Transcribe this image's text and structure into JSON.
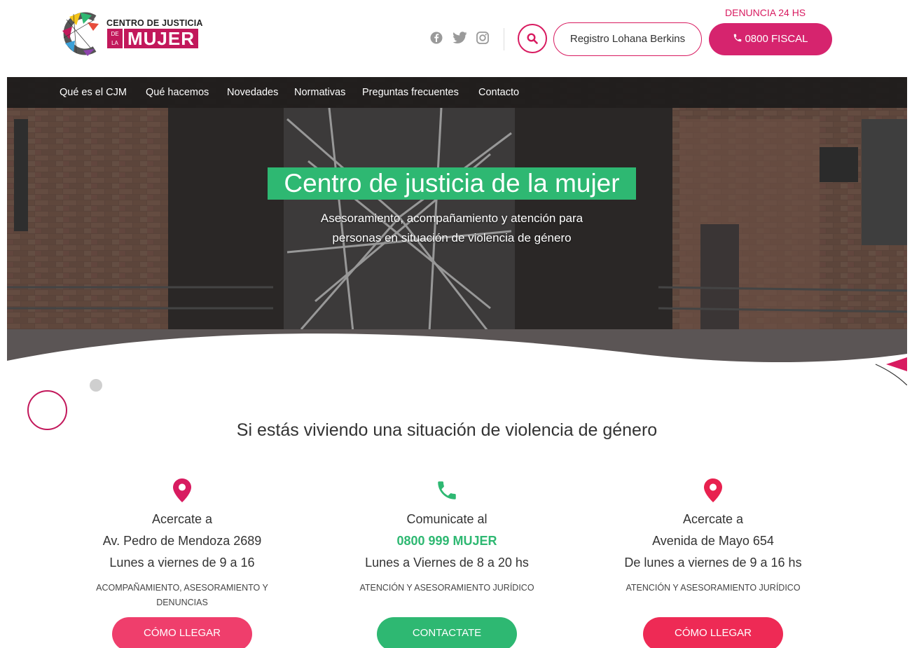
{
  "brand": {
    "top": "CENTRO DE JUSTICIA",
    "de": "DE",
    "la": "LA",
    "mujer": "MUJER"
  },
  "header": {
    "social": [
      "facebook-icon",
      "twitter-icon",
      "instagram-icon"
    ],
    "registro_label": "Registro Lohana Berkins",
    "denuncia_label": "DENUNCIA 24 HS",
    "fiscal_label": "0800 FISCAL"
  },
  "nav": {
    "items": [
      "Qué es el CJM",
      "Qué hacemos",
      "Novedades",
      "Normativas",
      "Preguntas frecuentes",
      "Contacto"
    ]
  },
  "hero": {
    "title": "Centro de justicia de la mujer",
    "subtitle_line1": "Asesoramiento, acompañamiento y atención para",
    "subtitle_line2": "personas en situación de violencia de género"
  },
  "section": {
    "title": "Si estás viviendo una situación de violencia de género"
  },
  "columns": [
    {
      "icon": "map-pin-icon",
      "line1": "Acercate a",
      "line2": "Av. Pedro de Mendoza 2689",
      "line3": "Lunes a viernes de 9 a 16",
      "desc": "ACOMPAÑAMIENTO, ASESORAMIENTO Y DENUNCIAS",
      "button": "CÓMO LLEGAR"
    },
    {
      "icon": "phone-icon",
      "line1": "Comunicate al",
      "line2": "0800 999 MUJER",
      "line3": "Lunes a Viernes de 8 a 20 hs",
      "desc": "ATENCIÓN Y ASESORAMIENTO JURÍDICO",
      "button": "CONTACTATE"
    },
    {
      "icon": "map-pin-icon",
      "line1": "Acercate a",
      "line2": "Avenida de Mayo 654",
      "line3": "De lunes a viernes de 9 a 16 hs",
      "desc": "ATENCIÓN Y ASESORAMIENTO JURÍDICO",
      "button": "CÓMO LLEGAR"
    }
  ],
  "colors": {
    "brand_pink": "#d81b60",
    "button_pink": "#ef3e6c",
    "brand_green": "#2eb872"
  }
}
